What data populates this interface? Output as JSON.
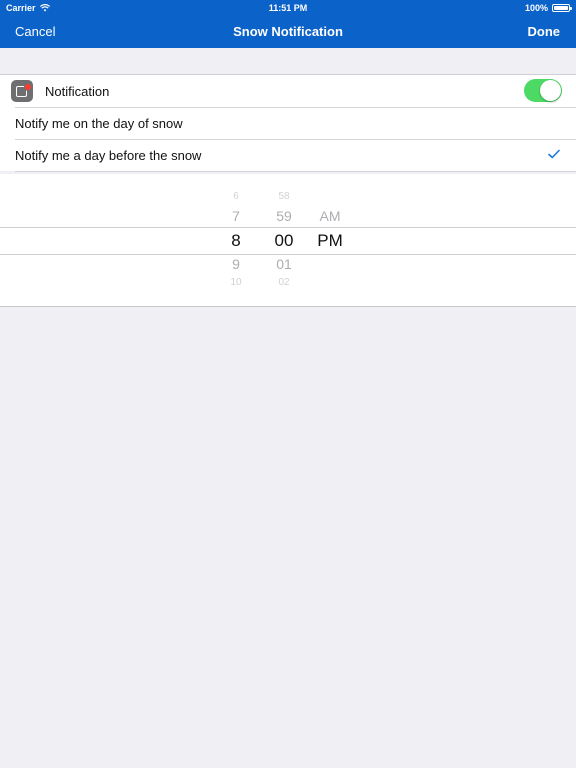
{
  "status_bar": {
    "carrier": "Carrier",
    "time": "11:51 PM",
    "battery": "100%"
  },
  "nav_bar": {
    "left_button": "Cancel",
    "title": "Snow Notification",
    "right_button": "Done",
    "background_color": "#0b62c8"
  },
  "settings": {
    "notification_label": "Notification",
    "notification_enabled": true,
    "options": [
      {
        "label": "Notify me on the day of snow",
        "selected": false
      },
      {
        "label": "Notify me a day before the snow",
        "selected": true
      }
    ]
  },
  "time_picker": {
    "hours": {
      "far_above": "6",
      "above": "7",
      "selected": "8",
      "below": "9",
      "far_below": "10"
    },
    "minutes": {
      "far_above": "58",
      "above": "59",
      "selected": "00",
      "below": "01",
      "far_below": "02"
    },
    "period": {
      "above": "AM",
      "selected": "PM"
    }
  },
  "colors": {
    "accent": "#0b62c8",
    "toggle_on": "#4cd964",
    "checkmark": "#1a7ae0"
  },
  "icons": {
    "wifi": "wifi-icon",
    "battery": "battery-icon",
    "app": "notification-app-icon",
    "check": "checkmark-icon"
  }
}
